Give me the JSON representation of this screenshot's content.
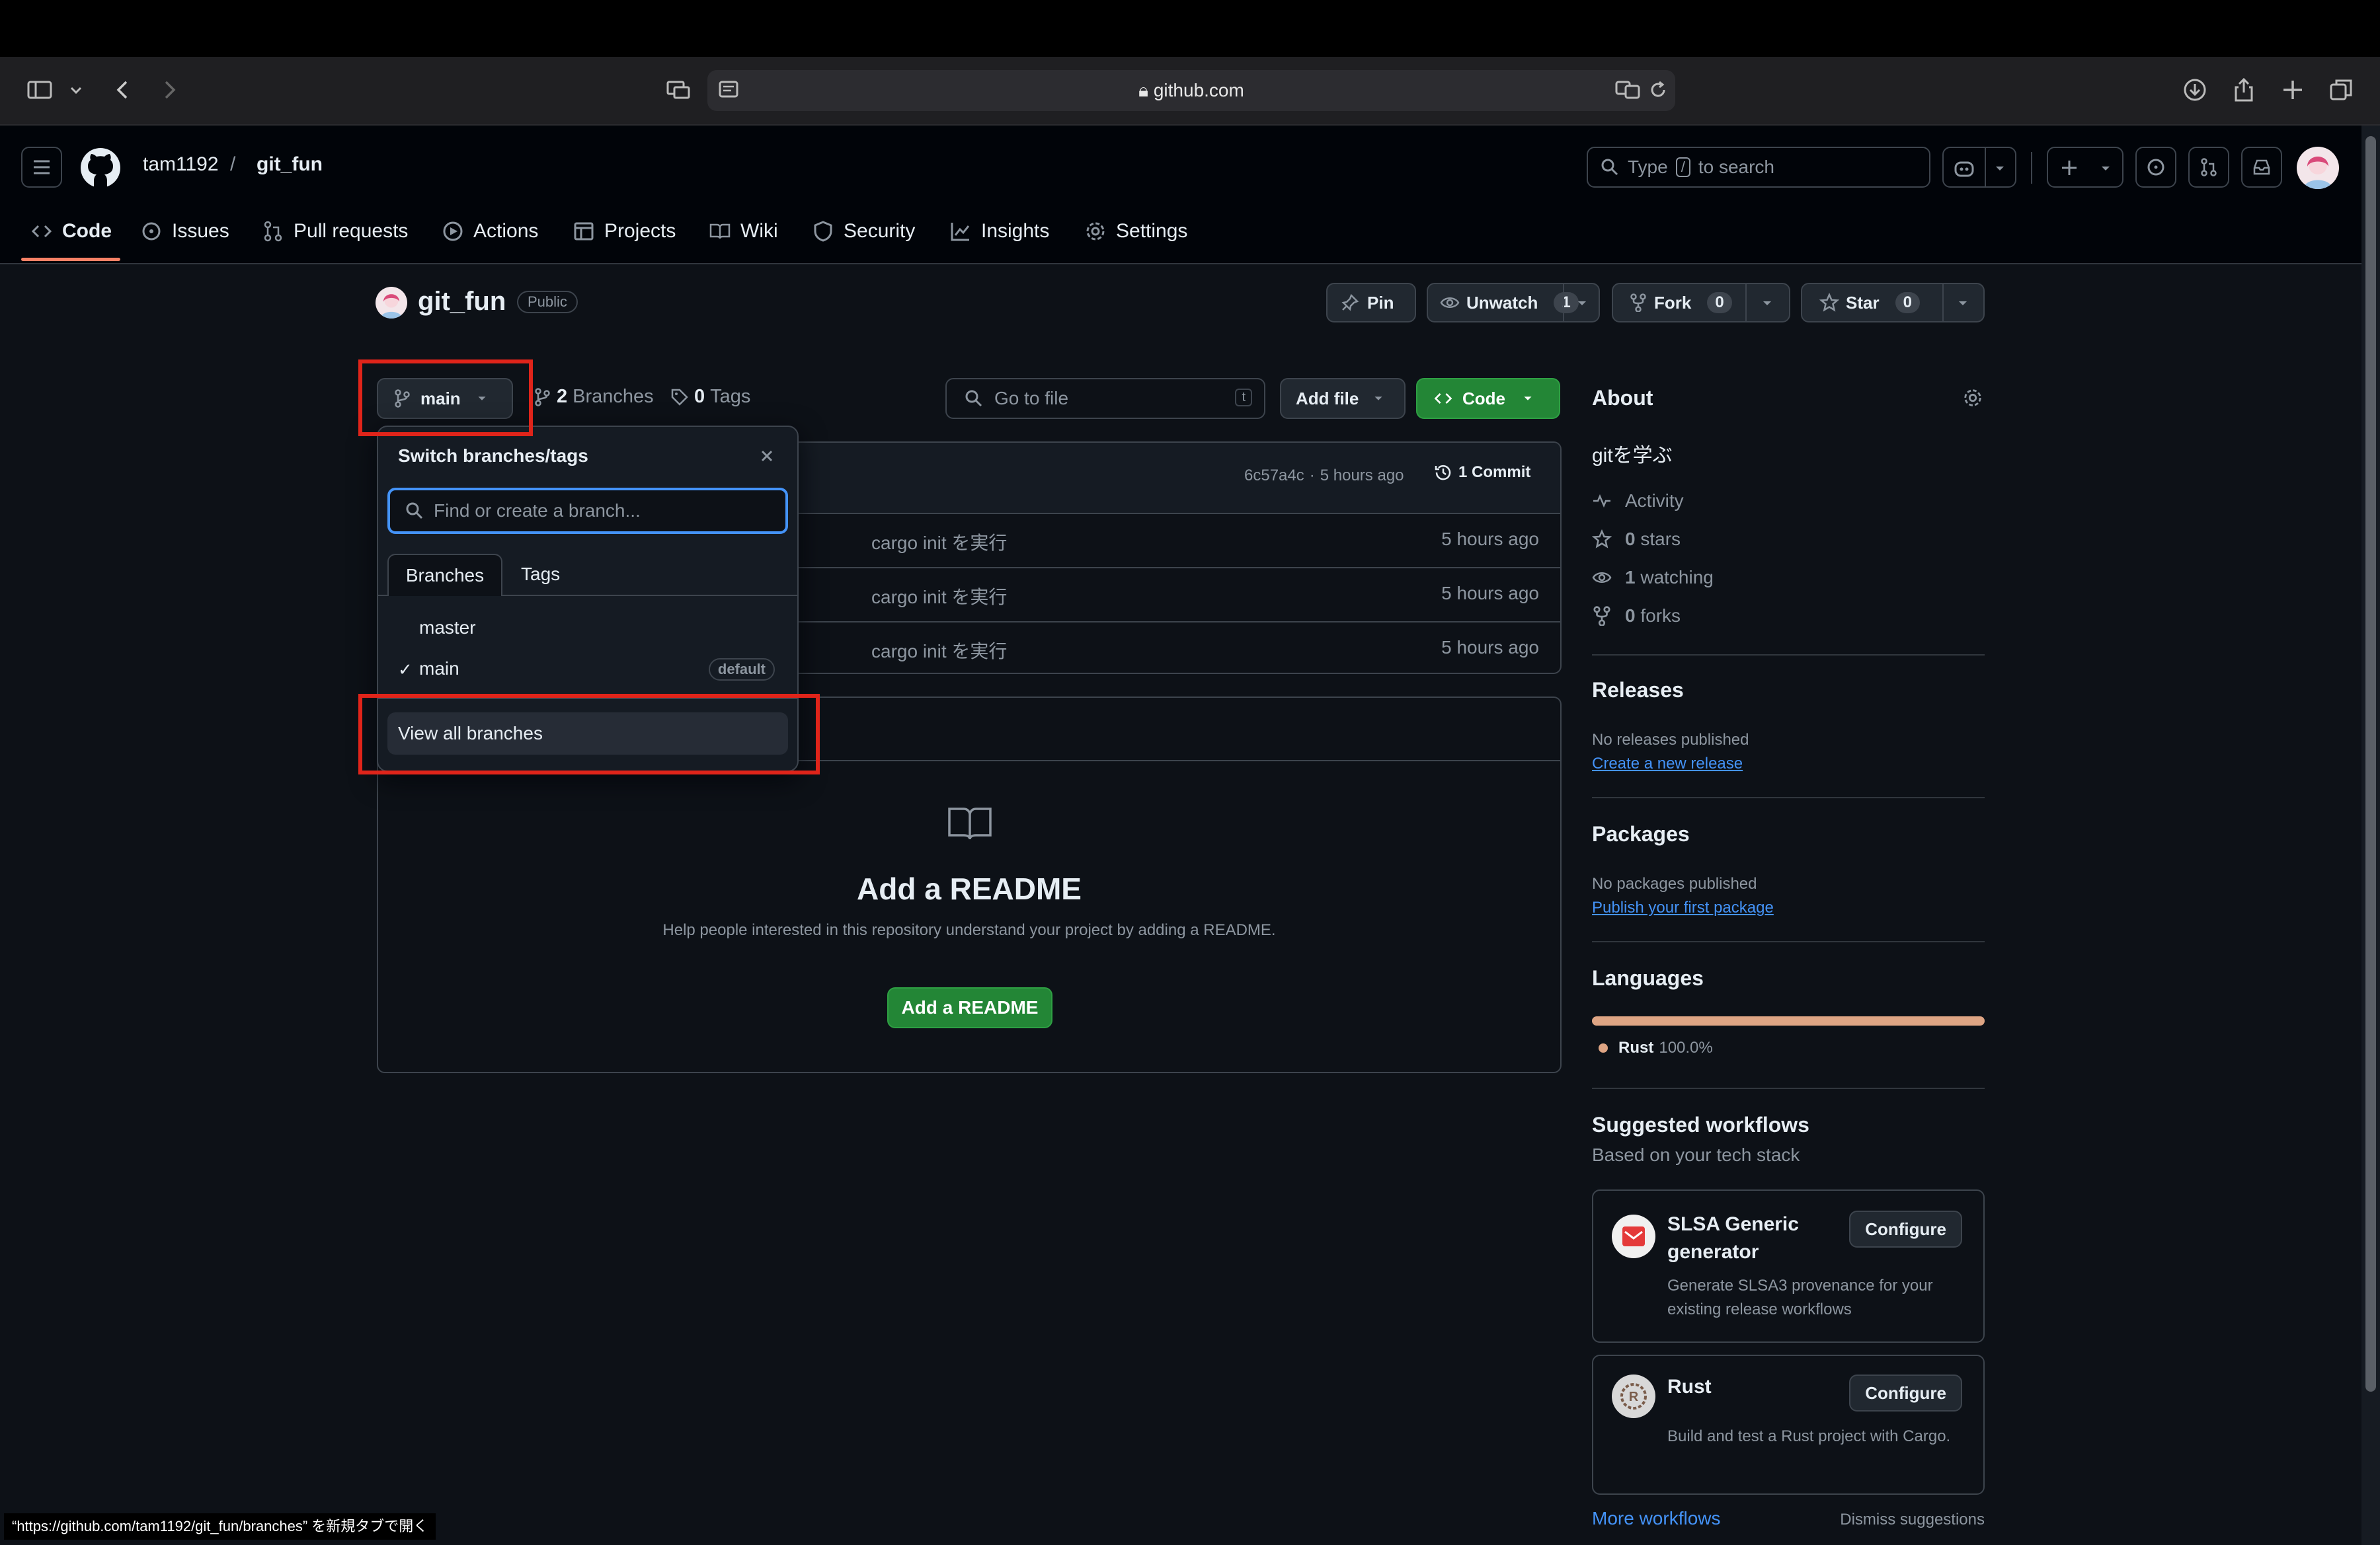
{
  "browser": {
    "url": "github.com"
  },
  "header": {
    "owner": "tam1192",
    "separator": "/",
    "repo": "git_fun",
    "search_prefix": "Type",
    "search_key": "/",
    "search_suffix": "to search"
  },
  "tabs": [
    {
      "label": "Code",
      "icon": "code-icon"
    },
    {
      "label": "Issues",
      "icon": "issue-icon"
    },
    {
      "label": "Pull requests",
      "icon": "pull-request-icon"
    },
    {
      "label": "Actions",
      "icon": "play-icon"
    },
    {
      "label": "Projects",
      "icon": "table-icon"
    },
    {
      "label": "Wiki",
      "icon": "book-icon"
    },
    {
      "label": "Security",
      "icon": "shield-icon"
    },
    {
      "label": "Insights",
      "icon": "graph-icon"
    },
    {
      "label": "Settings",
      "icon": "gear-icon"
    }
  ],
  "repo": {
    "name": "git_fun",
    "visibility": "Public",
    "pin": "Pin",
    "unwatch": "Unwatch",
    "watch_count": "1",
    "fork": "Fork",
    "fork_count": "0",
    "star": "Star",
    "star_count": "0"
  },
  "toolbar": {
    "branch": "main",
    "branches_count": "2",
    "branches_label": "Branches",
    "tags_count": "0",
    "tags_label": "Tags",
    "goto_placeholder": "Go to file",
    "goto_key": "t",
    "add_file": "Add file",
    "code": "Code"
  },
  "commit_bar": {
    "hash": "6c57a4c",
    "dot": "·",
    "time": "5 hours ago",
    "commits": "1 Commit"
  },
  "files": [
    {
      "message": "cargo init を実行",
      "time": "5 hours ago"
    },
    {
      "message": "cargo init を実行",
      "time": "5 hours ago"
    },
    {
      "message": "cargo init を実行",
      "time": "5 hours ago"
    }
  ],
  "readme": {
    "title": "Add a README",
    "desc": "Help people interested in this repository understand your project by adding a README.",
    "button": "Add a README"
  },
  "dropdown": {
    "title": "Switch branches/tags",
    "search_placeholder": "Find or create a branch...",
    "tab_branches": "Branches",
    "tab_tags": "Tags",
    "branches": [
      {
        "name": "master",
        "checked": false,
        "badge": ""
      },
      {
        "name": "main",
        "checked": true,
        "badge": "default"
      }
    ],
    "check": "✓",
    "view_all": "View all branches"
  },
  "about": {
    "heading": "About",
    "description": "gitを学ぶ",
    "activity": "Activity",
    "stars": "0",
    "stars_label": "stars",
    "watching": "1",
    "watching_label": "watching",
    "forks": "0",
    "forks_label": "forks"
  },
  "releases": {
    "heading": "Releases",
    "none": "No releases published",
    "link": "Create a new release"
  },
  "packages": {
    "heading": "Packages",
    "none": "No packages published",
    "link": "Publish your first package"
  },
  "languages": {
    "heading": "Languages",
    "items": [
      {
        "name": "Rust",
        "percent": "100.0%",
        "fraction": 1.0,
        "color": "#dea584"
      }
    ]
  },
  "workflows": {
    "heading": "Suggested workflows",
    "subheading": "Based on your tech stack",
    "items": [
      {
        "title": "SLSA Generic generator",
        "desc": "Generate SLSA3 provenance for your existing release workflows",
        "button": "Configure"
      },
      {
        "title": "Rust",
        "desc": "Build and test a Rust project with Cargo.",
        "button": "Configure"
      }
    ],
    "more": "More workflows",
    "dismiss": "Dismiss suggestions"
  },
  "status_bar": {
    "text": "“https://github.com/tam1192/git_fun/branches” を新規タブで開く"
  },
  "colors": {
    "background": "#0d1117",
    "accent_green": "#238636",
    "link_blue": "#4493f8",
    "highlight_red": "#e0241a",
    "tab_underline": "#f78166"
  }
}
